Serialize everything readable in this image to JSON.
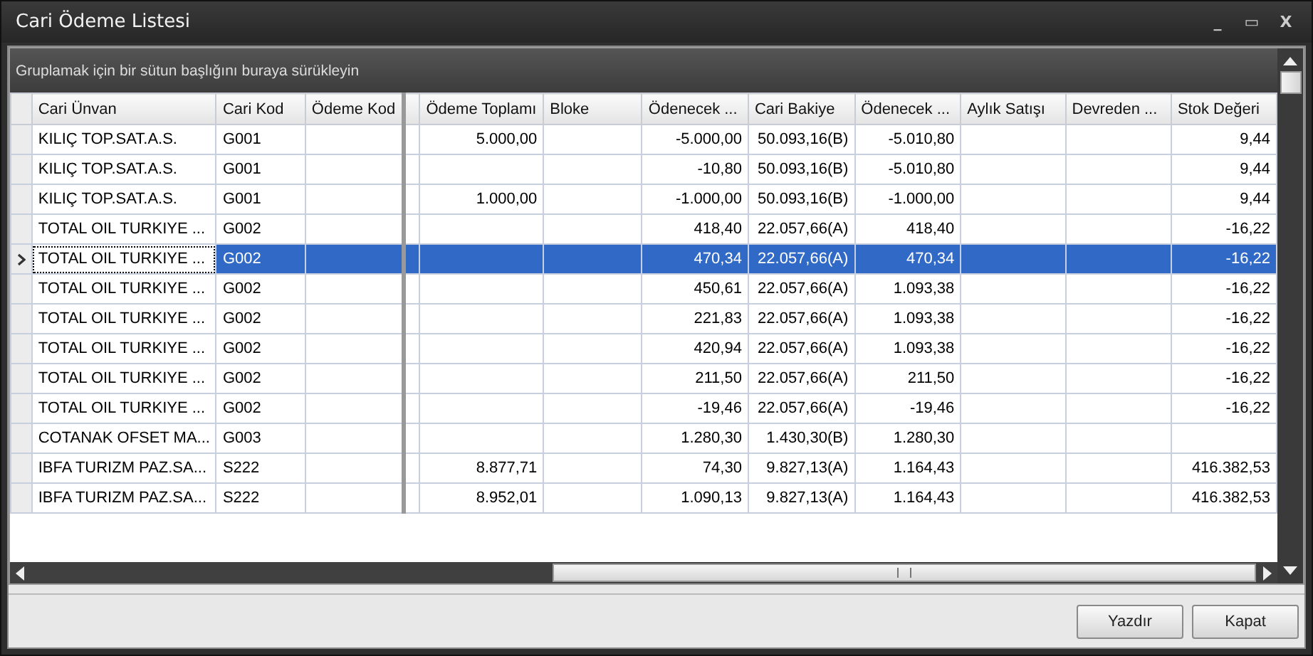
{
  "window": {
    "title": "Cari Ödeme Listesi",
    "controls": [
      "_",
      "▭",
      "X"
    ]
  },
  "group_panel": {
    "hint": "Gruplamak için bir sütun başlığını buraya sürükleyin"
  },
  "table": {
    "columns": [
      {
        "label": "Cari Ünvan",
        "kind": "text"
      },
      {
        "label": "Cari Kod",
        "kind": "text"
      },
      {
        "label": "Ödeme Kod",
        "kind": "text"
      },
      {
        "label": "Ödeme Toplamı",
        "kind": "number"
      },
      {
        "label": "Bloke",
        "kind": "number"
      },
      {
        "label": "Ödenecek ...",
        "kind": "number"
      },
      {
        "label": "Cari Bakiye",
        "kind": "number"
      },
      {
        "label": "Ödenecek ...",
        "kind": "number"
      },
      {
        "label": "Aylık Satışı",
        "kind": "number"
      },
      {
        "label": "Devreden ...",
        "kind": "number"
      },
      {
        "label": "Stok Değeri",
        "kind": "number"
      }
    ],
    "rows": [
      {
        "selected": false,
        "cells": [
          "KILIÇ TOP.SAT.A.S.",
          "G001",
          null,
          "5.000,00",
          null,
          "-5.000,00",
          "50.093,16(B)",
          "-5.010,80",
          null,
          null,
          "9,44"
        ]
      },
      {
        "selected": false,
        "cells": [
          "KILIÇ TOP.SAT.A.S.",
          "G001",
          null,
          null,
          null,
          "-10,80",
          "50.093,16(B)",
          "-5.010,80",
          null,
          null,
          "9,44"
        ]
      },
      {
        "selected": false,
        "cells": [
          "KILIÇ TOP.SAT.A.S.",
          "G001",
          null,
          "1.000,00",
          null,
          "-1.000,00",
          "50.093,16(B)",
          "-1.000,00",
          null,
          null,
          "9,44"
        ]
      },
      {
        "selected": false,
        "cells": [
          "TOTAL OIL TURKIYE ...",
          "G002",
          null,
          null,
          null,
          "418,40",
          "22.057,66(A)",
          "418,40",
          null,
          null,
          "-16,22"
        ]
      },
      {
        "selected": true,
        "cells": [
          "TOTAL OIL TURKIYE ...",
          "G002",
          null,
          null,
          null,
          "470,34",
          "22.057,66(A)",
          "470,34",
          null,
          null,
          "-16,22"
        ]
      },
      {
        "selected": false,
        "cells": [
          "TOTAL OIL TURKIYE ...",
          "G002",
          null,
          null,
          null,
          "450,61",
          "22.057,66(A)",
          "1.093,38",
          null,
          null,
          "-16,22"
        ]
      },
      {
        "selected": false,
        "cells": [
          "TOTAL OIL TURKIYE ...",
          "G002",
          null,
          null,
          null,
          "221,83",
          "22.057,66(A)",
          "1.093,38",
          null,
          null,
          "-16,22"
        ]
      },
      {
        "selected": false,
        "cells": [
          "TOTAL OIL TURKIYE ...",
          "G002",
          null,
          null,
          null,
          "420,94",
          "22.057,66(A)",
          "1.093,38",
          null,
          null,
          "-16,22"
        ]
      },
      {
        "selected": false,
        "cells": [
          "TOTAL OIL TURKIYE ...",
          "G002",
          null,
          null,
          null,
          "211,50",
          "22.057,66(A)",
          "211,50",
          null,
          null,
          "-16,22"
        ]
      },
      {
        "selected": false,
        "cells": [
          "TOTAL OIL TURKIYE ...",
          "G002",
          null,
          null,
          null,
          "-19,46",
          "22.057,66(A)",
          "-19,46",
          null,
          null,
          "-16,22"
        ]
      },
      {
        "selected": false,
        "cells": [
          "COTANAK OFSET MA...",
          "G003",
          null,
          null,
          null,
          "1.280,30",
          "1.430,30(B)",
          "1.280,30",
          null,
          null,
          null
        ]
      },
      {
        "selected": false,
        "cells": [
          "IBFA TURIZM PAZ.SA...",
          "S222",
          null,
          "8.877,71",
          null,
          "74,30",
          "9.827,13(A)",
          "1.164,43",
          null,
          null,
          "416.382,53"
        ]
      },
      {
        "selected": false,
        "cells": [
          "IBFA TURIZM PAZ.SA...",
          "S222",
          null,
          "8.952,01",
          null,
          "1.090,13",
          "9.827,13(A)",
          "1.164,43",
          null,
          null,
          "416.382,53"
        ]
      }
    ]
  },
  "buttons": [
    "Yazdır",
    "Kapat"
  ]
}
